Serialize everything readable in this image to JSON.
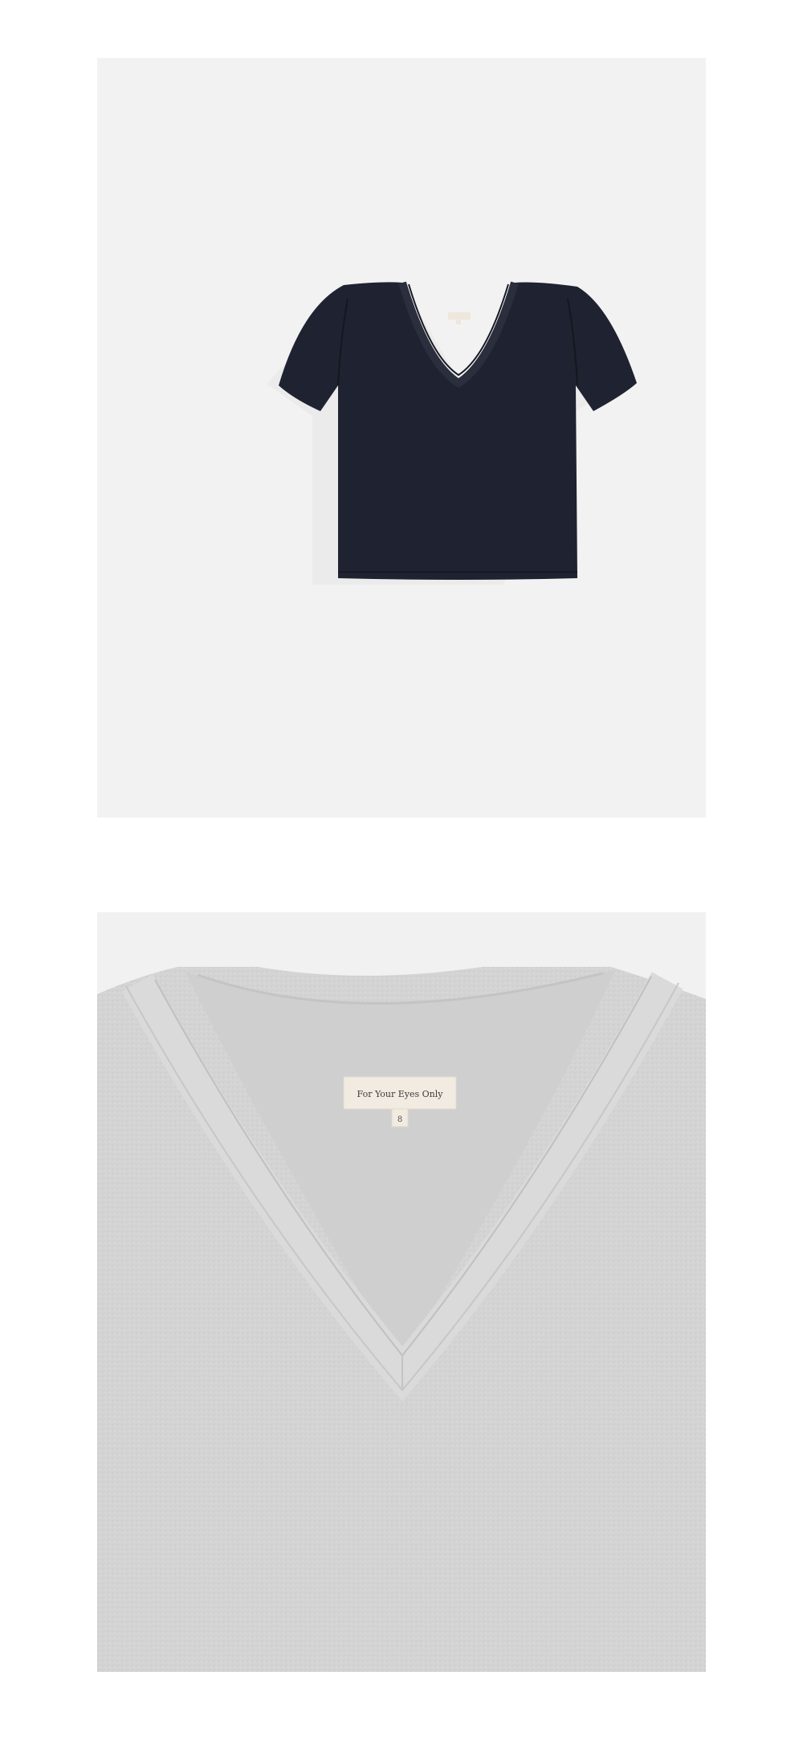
{
  "images": [
    {
      "name": "product-photo-front",
      "garment_color": "#1f2230",
      "background_color": "#f2f2f2"
    },
    {
      "name": "product-photo-neckline-detail",
      "garment_color": "#d4d4d4",
      "background_color": "#f1f1f1",
      "label": {
        "brand_text": "For Your Eyes Only",
        "size_text": "8"
      }
    }
  ]
}
